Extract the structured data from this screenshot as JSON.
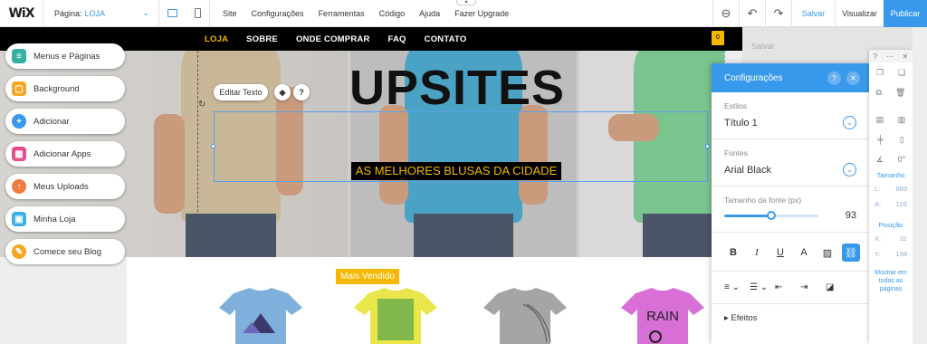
{
  "topbar": {
    "logo": "WiX",
    "page_label": "Página:",
    "page_value": "LOJA",
    "menu": [
      "Site",
      "Configurações",
      "Ferramentas",
      "Código",
      "Ajuda",
      "Fazer Upgrade"
    ],
    "save": "Salvar",
    "preview": "Visualizar",
    "publish": "Publicar",
    "icons": [
      "zoom-out-icon",
      "undo-icon",
      "redo-icon"
    ]
  },
  "site_nav": [
    "LOJA",
    "SOBRE",
    "ONDE COMPRAR",
    "FAQ",
    "CONTATO"
  ],
  "cart_count": "0",
  "hero": {
    "title": "UPSITES",
    "subtitle": "AS MELHORES BLUSAS DA CIDADE"
  },
  "text_toolbar": {
    "edit_text": "Editar Texto"
  },
  "badge": "Mais Vendido",
  "tshirts": [
    {
      "color": "#7fb0dc"
    },
    {
      "color": "#e8e64a"
    },
    {
      "color": "#a5a5a5"
    },
    {
      "color": "#d86fd6",
      "text": "RAIN"
    }
  ],
  "sidebar": [
    {
      "label": "Menus e Páginas",
      "color": "#35b0a0",
      "icon": "pages-icon"
    },
    {
      "label": "Background",
      "color": "#f5a623",
      "icon": "background-icon"
    },
    {
      "label": "Adicionar",
      "color": "#3899ec",
      "icon": "add-icon"
    },
    {
      "label": "Adicionar Apps",
      "color": "#e94b8f",
      "icon": "apps-icon"
    },
    {
      "label": "Meus Uploads",
      "color": "#f07b3f",
      "icon": "upload-icon"
    },
    {
      "label": "Minha Loja",
      "color": "#3ab1e6",
      "icon": "store-icon"
    },
    {
      "label": "Comece seu Blog",
      "color": "#f5a623",
      "icon": "blog-icon"
    }
  ],
  "settings": {
    "title": "Configurações",
    "styles_label": "Estilos",
    "styles_value": "Título 1",
    "fonts_label": "Fontes",
    "fonts_value": "Arial Black",
    "size_label": "Tamanho da fonte (px)",
    "size_value": "93",
    "size_fraction": 0.5,
    "effects": "Efeitos"
  },
  "right_panel": {
    "rotation": "0°",
    "size_label": "Tamanho",
    "w_label": "L:",
    "w_value": "889",
    "h_label": "A:",
    "h_value": "126",
    "pos_label": "Posição",
    "x_label": "X:",
    "x_value": "32",
    "y_label": "Y:",
    "y_value": "158",
    "show_all": "Mostrar em todas as páginas"
  },
  "ghost_save": "Salvar"
}
